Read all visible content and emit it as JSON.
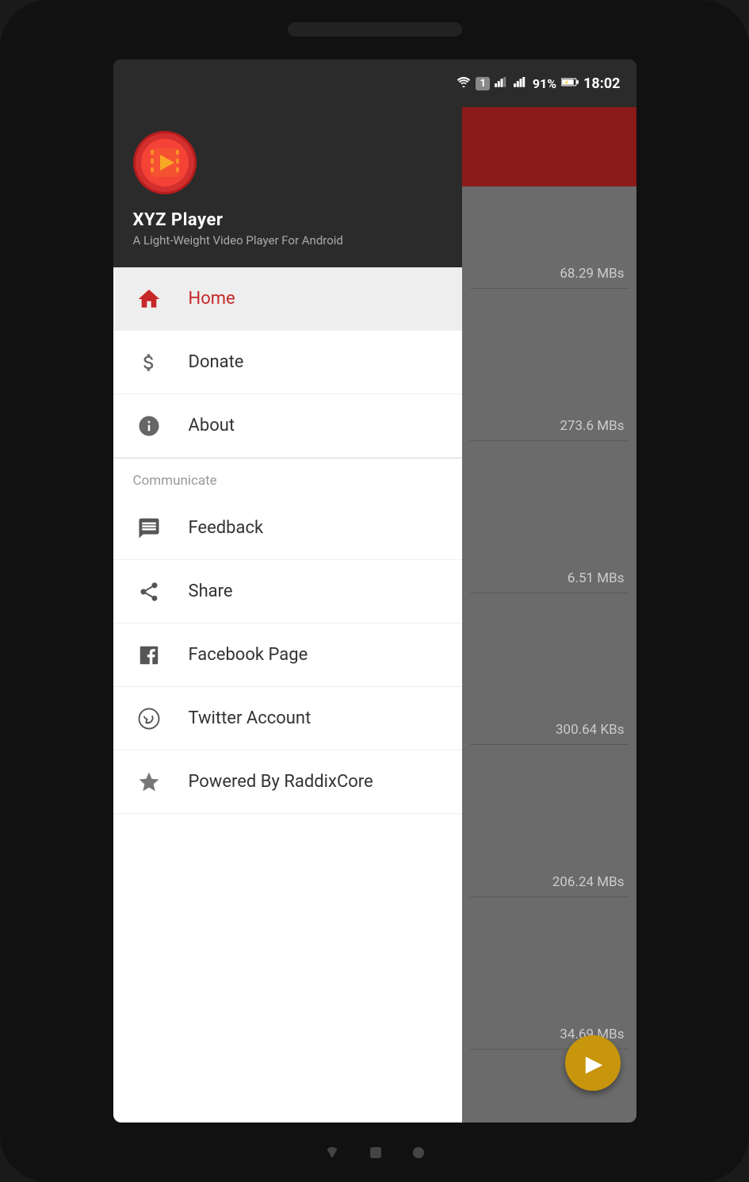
{
  "status_bar": {
    "battery_percent": "91%",
    "time": "18:02"
  },
  "app": {
    "name": "XYZ Player",
    "subtitle": "A Light-Weight Video Player For Android"
  },
  "menu": {
    "items": [
      {
        "id": "home",
        "label": "Home",
        "active": true,
        "icon": "home-icon"
      },
      {
        "id": "donate",
        "label": "Donate",
        "active": false,
        "icon": "dollar-icon"
      },
      {
        "id": "about",
        "label": "About",
        "active": false,
        "icon": "info-icon"
      }
    ],
    "communicate_section": {
      "title": "Communicate",
      "items": [
        {
          "id": "feedback",
          "label": "Feedback",
          "icon": "feedback-icon"
        },
        {
          "id": "share",
          "label": "Share",
          "icon": "share-icon"
        },
        {
          "id": "facebook",
          "label": "Facebook Page",
          "icon": "facebook-icon"
        },
        {
          "id": "twitter",
          "label": "Twitter Account",
          "icon": "twitter-icon"
        },
        {
          "id": "powered",
          "label": "Powered By RaddixCore",
          "icon": "star-icon"
        }
      ]
    }
  },
  "right_panel": {
    "file_sizes": [
      "68.29 MBs",
      "273.6 MBs",
      "6.51 MBs",
      "300.64 KBs",
      "206.24 MBs",
      "34.69 MBs"
    ]
  }
}
